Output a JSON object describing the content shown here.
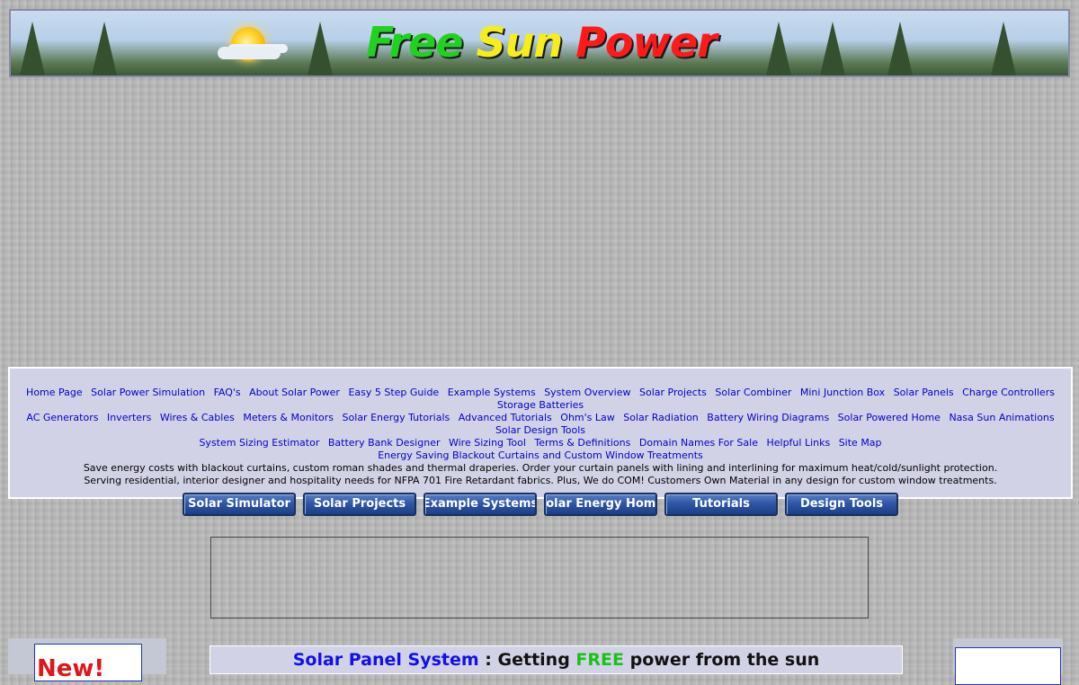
{
  "banner": {
    "title_free": "Free",
    "title_sun": "Sun",
    "title_power": "Power"
  },
  "nav": {
    "links_row1": [
      "Home Page",
      "Solar Power Simulation",
      "FAQ's",
      "About Solar Power",
      "Easy 5 Step Guide",
      "Example Systems",
      "System Overview",
      "Solar Projects",
      "Solar Combiner",
      "Mini Junction Box",
      "Solar Panels",
      "Charge Controllers",
      "Storage Batteries"
    ],
    "links_row2": [
      "AC Generators",
      "Inverters",
      "Wires & Cables",
      "Meters & Monitors",
      "Solar Energy Tutorials",
      "Advanced Tutorials",
      "Ohm's Law",
      "Solar Radiation",
      "Battery Wiring Diagrams",
      "Solar Powered Home",
      "Nasa Sun Animations",
      "Solar Design Tools"
    ],
    "links_row3": [
      "System Sizing Estimator",
      "Battery Bank Designer",
      "Wire Sizing Tool",
      "Terms & Definitions",
      "Domain Names For Sale",
      "Helpful Links",
      "Site Map"
    ],
    "promo_link": "Energy Saving Blackout Curtains and Custom Window Treatments",
    "promo_line1": "Save energy costs with blackout curtains, custom roman shades and thermal draperies. Order your curtain panels with lining and interlining for maximum heat/cold/sunlight protection.",
    "promo_line2": "Serving residential, interior designer and hospitality needs for NFPA 701 Fire Retardant fabrics. Plus, We do COM! Customers Own Material in any design for custom window treatments."
  },
  "buttons": [
    "Solar Simulator",
    "Solar Projects",
    "Example Systems",
    "Solar Energy Home",
    "Tutorials",
    "Design Tools"
  ],
  "sidebar_left": {
    "badge_text": "New!"
  },
  "main": {
    "title_part1": "Solar Panel System",
    "title_part2": " : Getting ",
    "title_part3": "FREE",
    "title_part4": " power from the sun"
  }
}
